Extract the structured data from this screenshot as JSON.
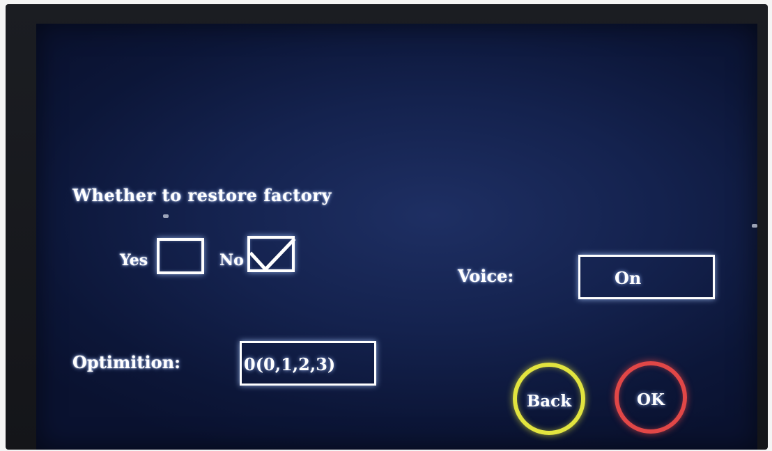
{
  "factory_restore": {
    "prompt": "Whether to restore factory",
    "yes_label": "Yes",
    "no_label": "No",
    "yes_checked": false,
    "no_checked": true
  },
  "voice": {
    "label": "Voice:",
    "value": "On"
  },
  "optimition": {
    "label": "Optimition:",
    "value": "0(0,1,2,3)"
  },
  "buttons": {
    "back_label": "Back",
    "ok_label": "OK"
  },
  "colors": {
    "screen_bg": "#14224e",
    "text": "#ffffff",
    "back_ring": "#e2e43f",
    "ok_ring": "#e14747"
  },
  "icons": {
    "checkmark": "check-icon"
  }
}
